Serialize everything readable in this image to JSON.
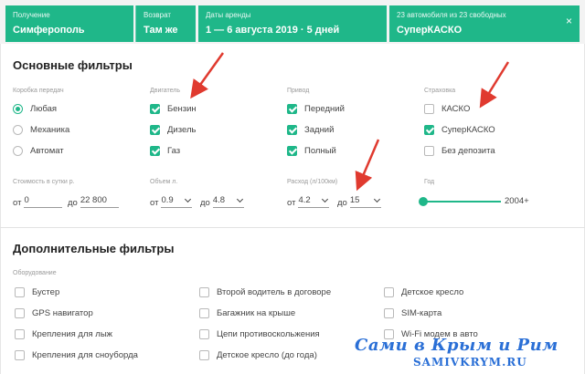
{
  "topbar": {
    "pickup": {
      "label": "Получение",
      "value": "Симферополь"
    },
    "return": {
      "label": "Возврат",
      "value": "Там же"
    },
    "dates": {
      "label": "Даты аренды",
      "value": "1 — 6 августа 2019 · 5 дней"
    },
    "insurance": {
      "label": "23 автомобиля из 23 свободных",
      "value": "СуперКАСКО"
    },
    "close_glyph": "×"
  },
  "main_filters": {
    "title": "Основные фильтры",
    "gearbox": {
      "label": "Коробка передач",
      "options": [
        {
          "text": "Любая",
          "selected": true
        },
        {
          "text": "Механика",
          "selected": false
        },
        {
          "text": "Автомат",
          "selected": false
        }
      ]
    },
    "engine": {
      "label": "Двигатель",
      "options": [
        {
          "text": "Бензин",
          "checked": true
        },
        {
          "text": "Дизель",
          "checked": true
        },
        {
          "text": "Газ",
          "checked": true
        }
      ]
    },
    "drive": {
      "label": "Привод",
      "options": [
        {
          "text": "Передний",
          "checked": true
        },
        {
          "text": "Задний",
          "checked": true
        },
        {
          "text": "Полный",
          "checked": true
        }
      ]
    },
    "insurance": {
      "label": "Страховка",
      "options": [
        {
          "text": "КАСКО",
          "checked": false
        },
        {
          "text": "СуперКАСКО",
          "checked": true
        },
        {
          "text": "Без депозита",
          "checked": false
        }
      ]
    },
    "price": {
      "label": "Стоимость в сутки р.",
      "from_prefix": "от",
      "from": "0",
      "to_prefix": "до",
      "to": "22 800"
    },
    "volume": {
      "label": "Объем л.",
      "from_prefix": "от",
      "from": "0.9",
      "to_prefix": "до",
      "to": "4.8"
    },
    "consumption": {
      "label": "Расход (л/100км)",
      "from_prefix": "от",
      "from": "4.2",
      "to_prefix": "до",
      "to": "15"
    },
    "year": {
      "label": "Год",
      "value": "2004+",
      "level": 0.0
    }
  },
  "extra_filters": {
    "title": "Дополнительные фильтры",
    "equipment_label": "Оборудование",
    "col1": [
      "Бустер",
      "GPS навигатор",
      "Крепления для лыж",
      "Крепления для сноуборда"
    ],
    "col2": [
      "Второй водитель в договоре",
      "Багажник на крыше",
      "Цепи противоскольжения",
      "Детское кресло (до года)"
    ],
    "col3": [
      "Детское кресло",
      "SIM-карта",
      "Wi-Fi модем в авто"
    ]
  },
  "watermark": {
    "line1": "Сами в Крым и Рим",
    "line2": "SAMIVKRYM.RU"
  },
  "colors": {
    "accent": "#1fb789",
    "arrow": "#e03a2f",
    "watermark": "#2a6fd6"
  }
}
